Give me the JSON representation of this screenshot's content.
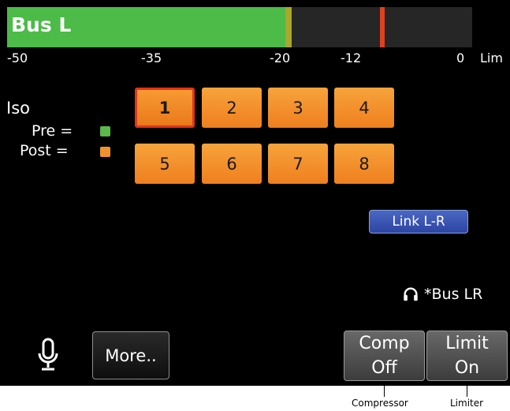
{
  "meter": {
    "title": "Bus L",
    "fill_level_db": -20,
    "peak_hold_db": -20,
    "limit_marker_db": -7,
    "scale_labels": [
      "-50",
      "-35",
      "-20",
      "-12",
      "0",
      "Lim"
    ],
    "colors": {
      "fill": "#4cbb48",
      "peak": "#a9a82a",
      "limit": "#e0401d",
      "background": "#262626"
    }
  },
  "iso": {
    "title": "Iso",
    "pre_label": "Pre =",
    "post_label": "Post =",
    "pre_color": "#5cb84a",
    "post_color": "#f0922c"
  },
  "channels": [
    {
      "label": "1",
      "selected": true
    },
    {
      "label": "2",
      "selected": false
    },
    {
      "label": "3",
      "selected": false
    },
    {
      "label": "4",
      "selected": false
    },
    {
      "label": "5",
      "selected": false
    },
    {
      "label": "6",
      "selected": false
    },
    {
      "label": "7",
      "selected": false
    },
    {
      "label": "8",
      "selected": false
    }
  ],
  "link_button": "Link L-R",
  "headphone": {
    "icon": "headphones-icon",
    "label": "*Bus LR"
  },
  "mic_icon": "microphone-icon",
  "more_button": "More..",
  "comp_button": {
    "line1": "Comp",
    "line2": "Off"
  },
  "limit_button": {
    "line1": "Limit",
    "line2": "On"
  },
  "callouts": {
    "compressor": "Compressor",
    "limiter": "Limiter"
  }
}
